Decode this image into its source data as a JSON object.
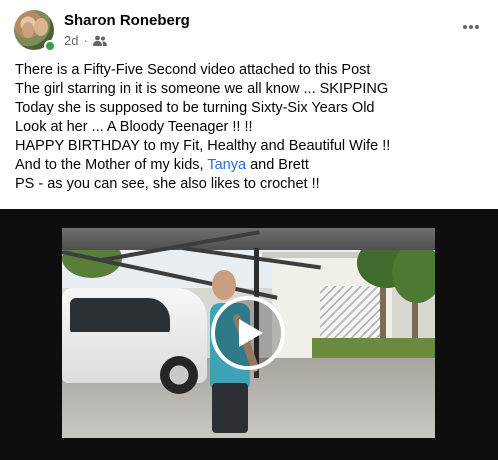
{
  "post": {
    "author": "Sharon Roneberg",
    "time": "2d",
    "separator": "·",
    "audience_icon": "friends-icon",
    "more_icon": "more-horizontal-icon",
    "text_lines": [
      "There is a Fifty-Five Second video attached to this Post",
      "The girl starring in it is someone we all know ... SKIPPING",
      "Today she is supposed to be turning Sixty-Six Years Old",
      "Look at her ... A Bloody Teenager !! !!",
      "HAPPY BIRTHDAY to my Fit, Healthy and Beautiful Wife !!"
    ],
    "mother_line": {
      "prefix": "And to the Mother of my kids, ",
      "mention": "Tanya",
      "suffix": " and Brett"
    },
    "ps_line": "PS - as you can see, she also likes to crochet !!"
  },
  "video": {
    "play_icon": "play-icon"
  },
  "colors": {
    "mention": "#216fdb",
    "online": "#31a24c",
    "meta": "#65676b",
    "video_bg": "#0e0e0e"
  }
}
